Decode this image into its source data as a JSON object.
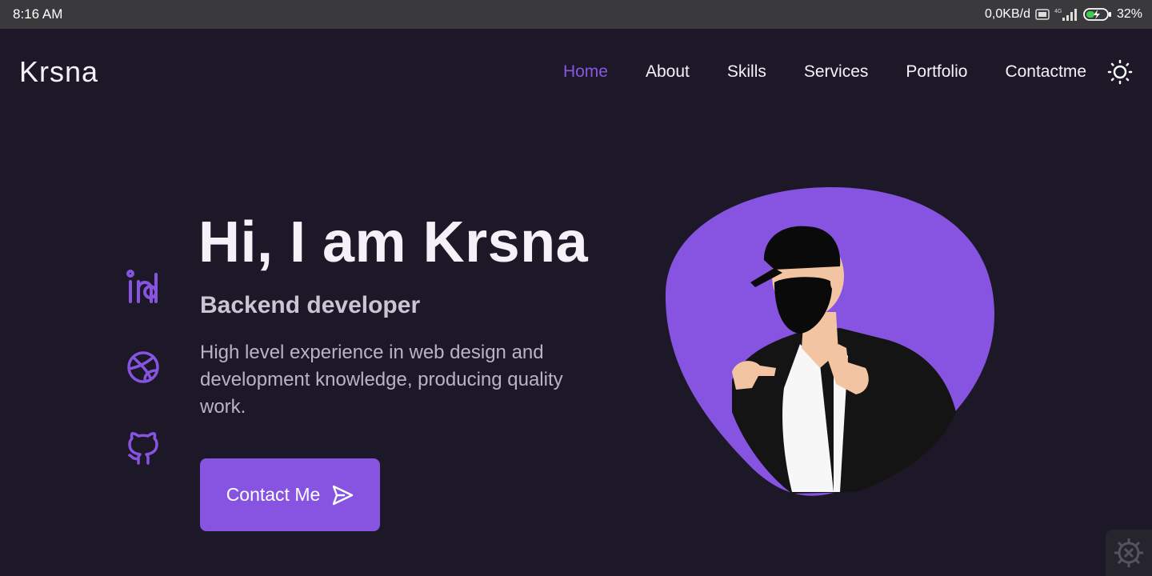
{
  "status_bar": {
    "time": "8:16 AM",
    "network_speed": "0,0KB/d",
    "network_type": "4G",
    "battery": "32%",
    "icons": [
      "volte-icon",
      "signal-icon",
      "battery-charging-icon"
    ]
  },
  "header": {
    "logo": "Krsna",
    "nav": [
      {
        "label": "Home",
        "active": true
      },
      {
        "label": "About",
        "active": false
      },
      {
        "label": "Skills",
        "active": false
      },
      {
        "label": "Services",
        "active": false
      },
      {
        "label": "Portfolio",
        "active": false
      },
      {
        "label": "Contactme",
        "active": false
      }
    ],
    "theme_icon": "sun-icon"
  },
  "social": [
    "linkedin-icon",
    "dribbble-icon",
    "github-icon"
  ],
  "hero": {
    "title": "Hi, I am Krsna",
    "subtitle": "Backend developer",
    "description": "High level experience in web design and development knowledge, producing quality work.",
    "button_label": "Contact Me",
    "button_icon": "send-icon"
  },
  "colors": {
    "background": "#1d1827",
    "accent": "#8654e0",
    "text": "#f4f2f8"
  },
  "fab_icon": "settings-gear-icon"
}
